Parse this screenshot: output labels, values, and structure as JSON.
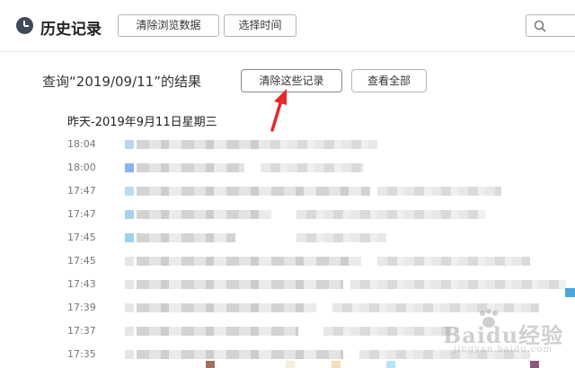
{
  "header": {
    "title": "历史记录",
    "clear_browsing_label": "清除浏览数据",
    "select_time_label": "选择时间",
    "search_placeholder": ""
  },
  "query": {
    "text": "查询“2019/09/11”的结果",
    "clear_these_label": "清除这些记录",
    "view_all_label": "查看全部"
  },
  "date_heading": "昨天-2019年9月11日星期三",
  "history": {
    "times": [
      "18:04",
      "18:00",
      "17:47",
      "17:47",
      "17:45",
      "17:45",
      "17:43",
      "17:39",
      "17:37",
      "17:35"
    ],
    "favicon_colors": [
      "#bcd3f2",
      "#8ab4f0",
      "#b9dcf2",
      "#a9d2ea",
      "#9fd0ee",
      "#e6e6e6",
      "#e6e6e6",
      "#e6e6e6",
      "#e6e6e6",
      "#e6e6e6"
    ]
  },
  "annotation_arrow_color": "#e8262b",
  "watermark": {
    "text": "Baidu经验",
    "sub": "jingyan.baidu.com"
  }
}
